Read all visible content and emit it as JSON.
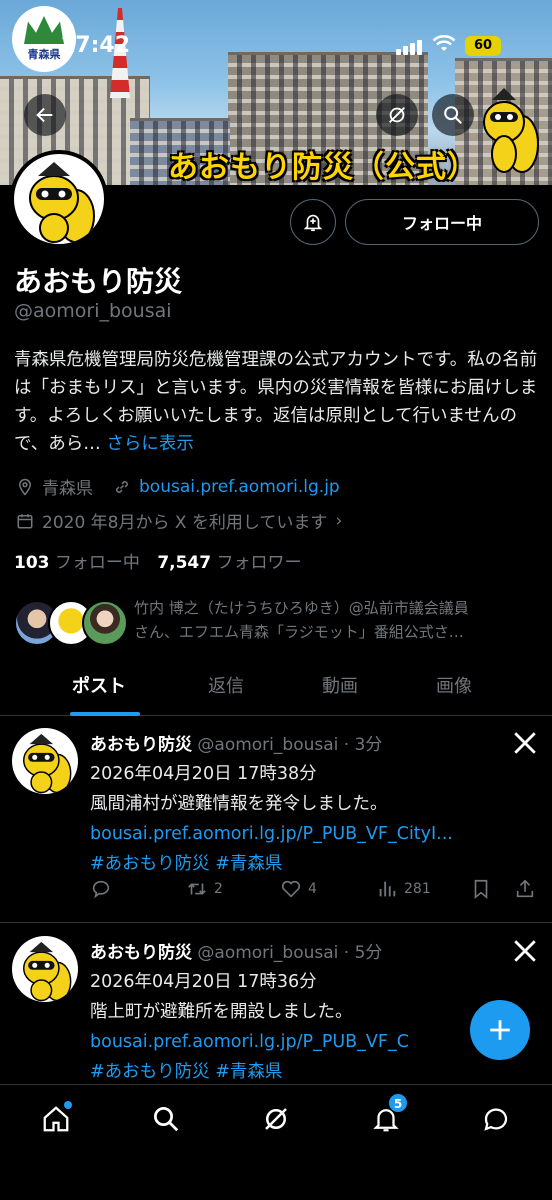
{
  "status_bar": {
    "time": "17:42",
    "battery": "60"
  },
  "banner": {
    "crest_text": "青森県",
    "title": "あおもり防災（公式）"
  },
  "profile": {
    "name": "あおもり防災",
    "handle": "@aomori_bousai",
    "follow_button": "フォロー中",
    "bio": "青森県危機管理局防災危機管理課の公式アカウントです。私の名前は「おまもリス」と言います。県内の災害情報を皆様にお届けします。よろしくお願いいたします。返信は原則として行いませんので、あら…",
    "bio_more": "さらに表示",
    "location": "青森県",
    "website": "bousai.pref.aomori.lg.jp",
    "joined": "2020 年8月から X を利用しています",
    "following_count": "103",
    "following_label": "フォロー中",
    "followers_count": "7,547",
    "followers_label": "フォロワー",
    "followed_by_line1": "竹内 博之（たけうちひろゆき）@弘前市議会議員",
    "followed_by_line2": "さん、エフエム青森「ラジモット」番組公式さ…"
  },
  "tabs": [
    "ポスト",
    "返信",
    "動画",
    "画像"
  ],
  "posts": [
    {
      "name": "あおもり防災",
      "handle_time": "@aomori_bousai · 3分",
      "date": "2026年04月20日 17時38分",
      "text": "風間浦村が避難情報を発令しました。",
      "link": "bousai.pref.aomori.lg.jp/P_PUB_VF_CityI...",
      "tags": "#あおもり防災 #青森県",
      "reposts": "2",
      "likes": "4",
      "views": "281"
    },
    {
      "name": "あおもり防災",
      "handle_time": "@aomori_bousai · 5分",
      "date": "2026年04月20日 17時36分",
      "text": "階上町が避難所を開設しました。",
      "link": "bousai.pref.aomori.lg.jp/P_PUB_VF_C",
      "tags": "#あおもり防災 #青森県"
    }
  ],
  "nav": {
    "notifications_badge": "5"
  }
}
